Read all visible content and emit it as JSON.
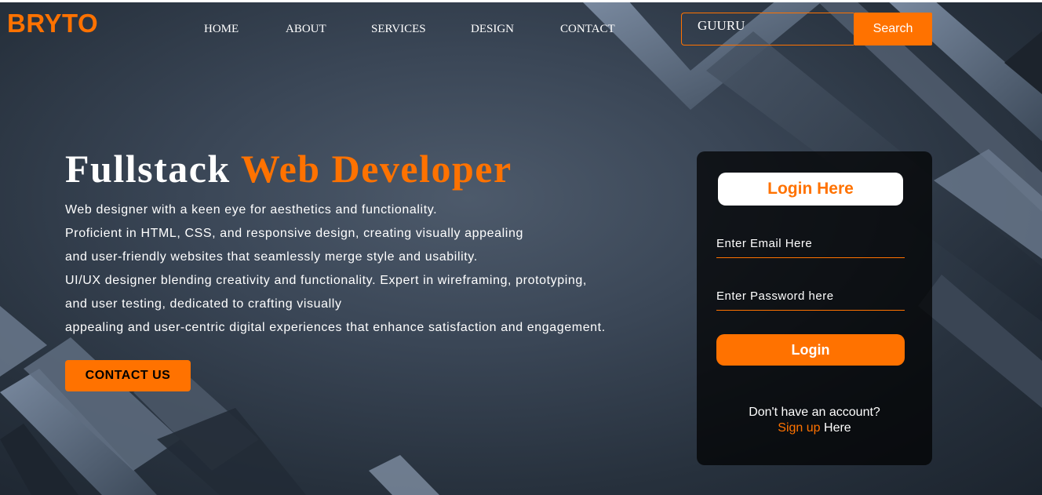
{
  "brand": {
    "logo": "BRYTO",
    "accent": "#ff7200"
  },
  "nav": {
    "items": [
      "HOME",
      "ABOUT",
      "SERVICES",
      "DESIGN",
      "CONTACT"
    ]
  },
  "search": {
    "value": "GUURU",
    "button_label": "Search"
  },
  "hero": {
    "title_plain": "Fullstack",
    "title_accent": "Web Developer",
    "lines": [
      "Web designer with a keen eye for aesthetics and functionality.",
      "Proficient in HTML, CSS, and responsive design, creating visually appealing",
      "and user-friendly websites that seamlessly merge style and usability.",
      "UI/UX designer blending creativity and functionality. Expert in wireframing, prototyping,",
      "and user testing, dedicated to crafting visually",
      "appealing and user-centric digital experiences that enhance satisfaction and engagement."
    ],
    "contact_button": "CONTACT US"
  },
  "login": {
    "title": "Login Here",
    "email_placeholder": "Enter Email Here",
    "password_placeholder": "Enter Password here",
    "button_label": "Login",
    "no_account_text": "Don't have an account?",
    "signup_link": "Sign up",
    "signup_suffix": "Here"
  }
}
